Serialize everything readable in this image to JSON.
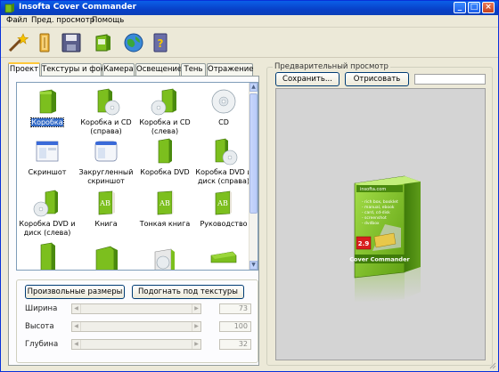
{
  "window": {
    "title": "Insofta Cover Commander",
    "controls": {
      "minimize": "_",
      "maximize": "□",
      "close": "×"
    }
  },
  "menu": [
    "Файл",
    "Пред. просмотр",
    "Помощь"
  ],
  "toolbar": [
    "magic-wand-icon",
    "open-folder-icon",
    "save-disk-icon",
    "export-icon",
    "web-globe-icon",
    "help-book-icon"
  ],
  "tabs": [
    "Проект",
    "Текстуры и фон",
    "Камера",
    "Освещение",
    "Тень",
    "Отражение"
  ],
  "gallery": {
    "items": [
      {
        "label": "Коробка",
        "selected": true
      },
      {
        "label": "Коробка и CD (справа)"
      },
      {
        "label": "Коробка и CD (слева)"
      },
      {
        "label": "CD"
      },
      {
        "label": "Скриншот"
      },
      {
        "label": "Закругленный скриншот"
      },
      {
        "label": "Коробка DVD"
      },
      {
        "label": "Коробка DVD и диск (справа)"
      },
      {
        "label": "Коробка DVD и диск (слева)"
      },
      {
        "label": "Книга"
      },
      {
        "label": "Тонкая книга"
      },
      {
        "label": "Руководство"
      },
      {
        "label": ""
      },
      {
        "label": ""
      },
      {
        "label": ""
      },
      {
        "label": ""
      }
    ]
  },
  "size_buttons": {
    "custom": "Произвольные размеры",
    "fit": "Подогнать под текстуры"
  },
  "dimensions": [
    {
      "label": "Ширина",
      "value": "73"
    },
    {
      "label": "Высота",
      "value": "100"
    },
    {
      "label": "Глубина",
      "value": "32"
    }
  ],
  "preview": {
    "group_title": "Предварительный просмотр",
    "save_button": "Сохранить...",
    "render_button": "Отрисовать",
    "box": {
      "site": "insofta.com",
      "bullets": [
        "- rich box, booklet",
        "- manual, ebook",
        "- card, cd-disk",
        "- screenshot",
        "- dvdbox"
      ],
      "version": "2.9",
      "name": "Cover Commander"
    }
  },
  "colors": {
    "accent_green": "#7cbf1e",
    "dark_green": "#4a8a0e",
    "selection": "#3169c6",
    "badge_red": "#d81e1e"
  }
}
